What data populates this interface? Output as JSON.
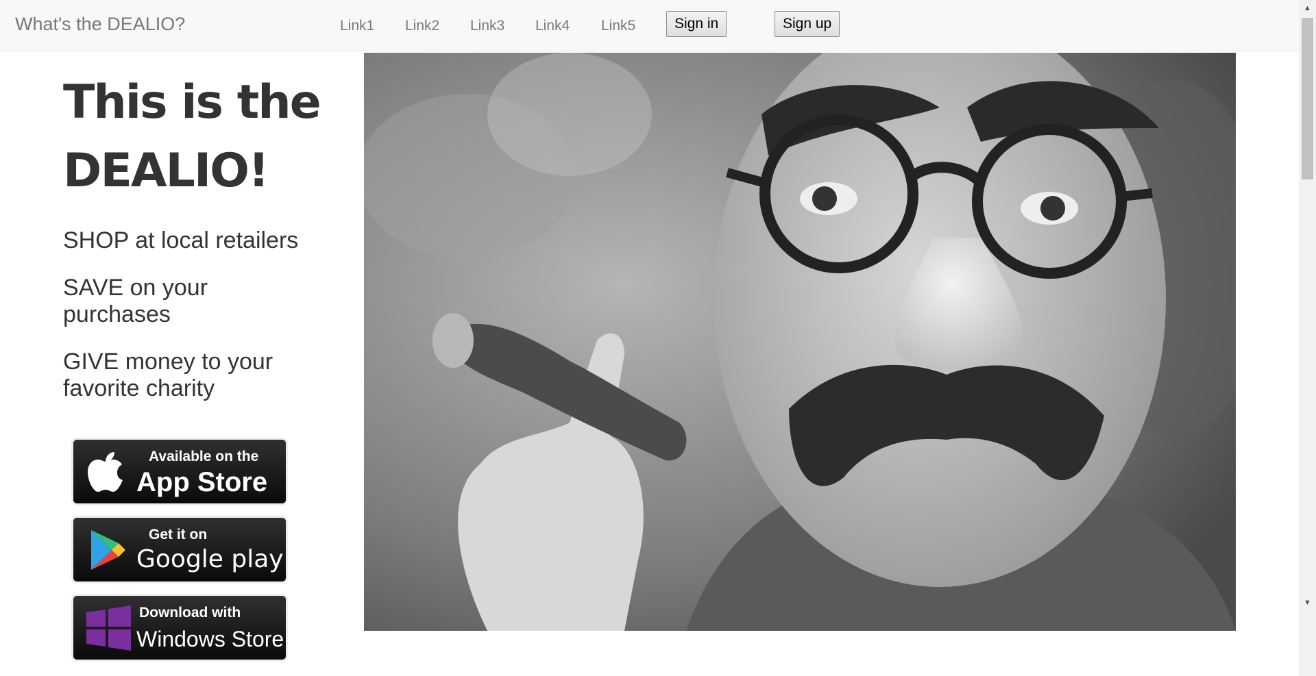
{
  "navbar": {
    "brand": "What's the DEALIO?",
    "links": [
      "Link1",
      "Link2",
      "Link3",
      "Link4",
      "Link5"
    ],
    "sign_in": "Sign in",
    "sign_up": "Sign up"
  },
  "hero": {
    "title_line1": "This is the",
    "title_line2": "DEALIO!",
    "bullets": [
      "SHOP at local retailers",
      "SAVE on your purchases",
      "GIVE money to your favorite charity"
    ]
  },
  "badges": {
    "app_store": {
      "small": "Available on the",
      "big": "App Store",
      "icon": "apple-icon"
    },
    "google_play": {
      "small": "Get it on",
      "big": "Google play",
      "icon": "play-triangle-icon"
    },
    "windows_store": {
      "small": "Download with",
      "big": "Windows Store",
      "icon": "windows-logo-icon"
    }
  },
  "colors": {
    "navbar_bg": "#f8f8f8",
    "nav_text": "#777777",
    "heading_text": "#333333",
    "badge_bg": "#111111",
    "windows_purple": "#7b2f9e"
  }
}
